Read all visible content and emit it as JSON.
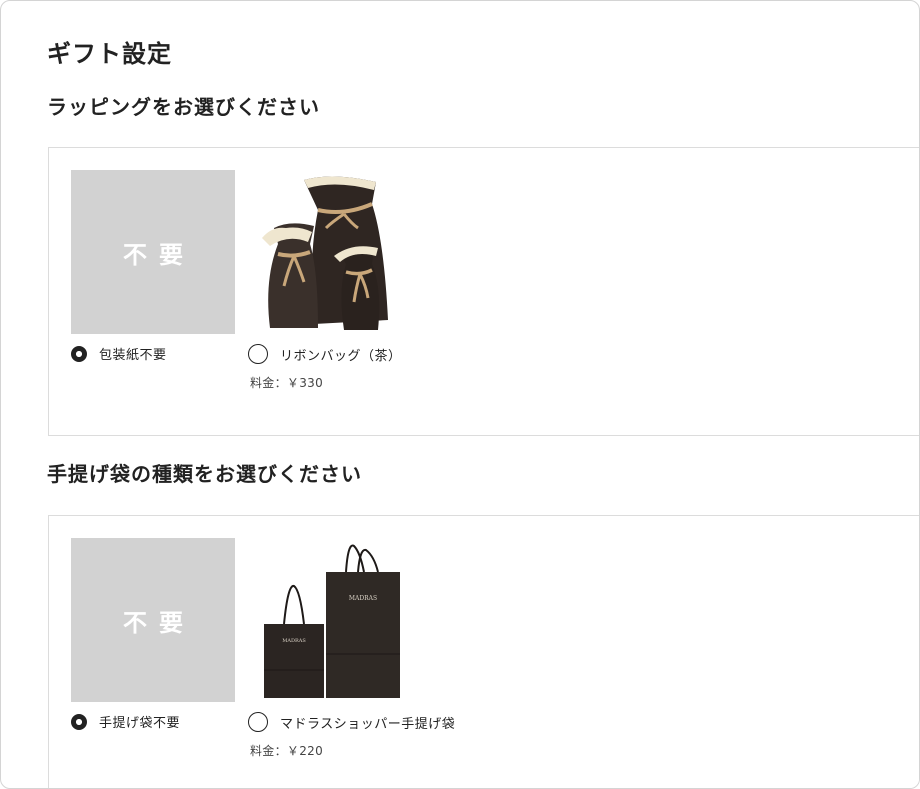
{
  "page": {
    "title": "ギフト設定"
  },
  "wrapping": {
    "heading": "ラッピングをお選びください",
    "options": [
      {
        "thumb_text": "不要",
        "label": "包装紙不要",
        "selected": true
      },
      {
        "label": "リボンバッグ（茶）",
        "price": "料金：￥330",
        "selected": false,
        "image_icon": "ribbon-gift-bags"
      }
    ]
  },
  "handbag": {
    "heading": "手提げ袋の種類をお選びください",
    "options": [
      {
        "thumb_text": "不要",
        "label": "手提げ袋不要",
        "selected": true
      },
      {
        "label": "マドラスショッパー手提げ袋",
        "price": "料金：￥220",
        "selected": false,
        "image_icon": "shopping-bags"
      }
    ]
  },
  "colors": {
    "none_bg": "#d2d2d2",
    "bag_brown": "#2f2622",
    "ribbon": "#c9a77a",
    "cream": "#efe6cf"
  }
}
